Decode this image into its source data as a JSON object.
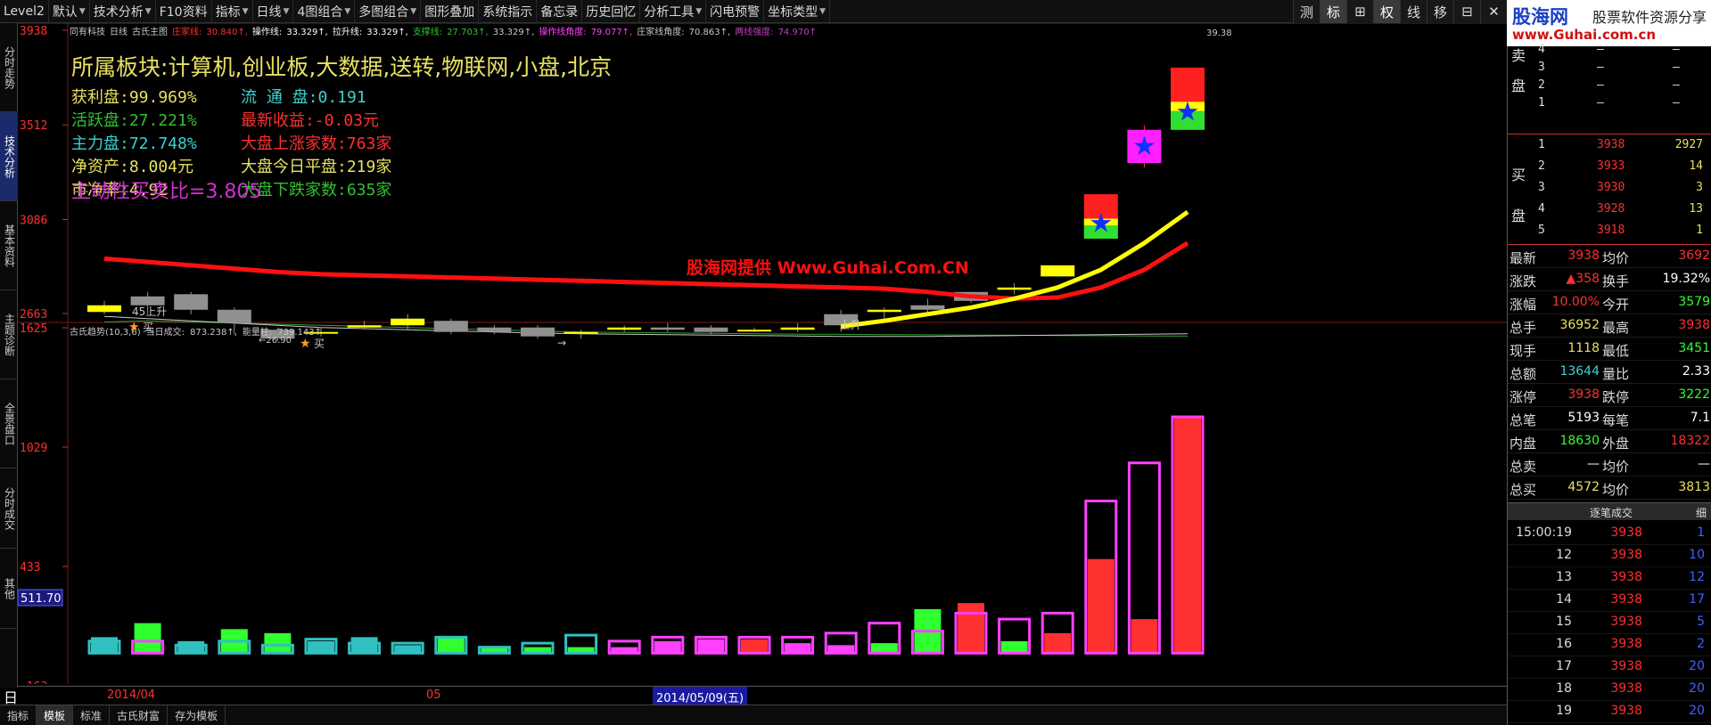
{
  "menu": [
    {
      "label": "Level2",
      "dd": false
    },
    {
      "label": "默认",
      "dd": true
    },
    {
      "label": "技术分析",
      "dd": true
    },
    {
      "label": "F10资料",
      "dd": false
    },
    {
      "label": "指标",
      "dd": true
    },
    {
      "label": "日线",
      "dd": true
    },
    {
      "label": "4图组合",
      "dd": true
    },
    {
      "label": "多图组合",
      "dd": true
    },
    {
      "label": "图形叠加",
      "dd": false
    },
    {
      "label": "系统指示",
      "dd": false
    },
    {
      "label": "备忘录",
      "dd": false
    },
    {
      "label": "历史回忆",
      "dd": false
    },
    {
      "label": "分析工具",
      "dd": true
    },
    {
      "label": "闪电预警",
      "dd": false
    },
    {
      "label": "坐标类型",
      "dd": true
    }
  ],
  "tool_buttons": [
    {
      "label": "测",
      "on": false
    },
    {
      "label": "标",
      "on": true
    },
    {
      "label": "⊞",
      "on": false
    },
    {
      "label": "权",
      "on": true
    },
    {
      "label": "线",
      "on": false
    },
    {
      "label": "移",
      "on": false
    },
    {
      "label": "⊟",
      "on": false
    },
    {
      "label": "✕",
      "on": false
    }
  ],
  "logo": {
    "l1": "股海网",
    "l2": "股票软件资源分享",
    "l3": "www.Guhai.com.cn"
  },
  "left_tabs": [
    {
      "label": "分时走势",
      "active": false
    },
    {
      "label": "技术分析",
      "active": true
    },
    {
      "label": "基本资料",
      "active": false
    },
    {
      "label": "主题诊断",
      "active": false
    },
    {
      "label": "全景盘口",
      "active": false
    },
    {
      "label": "分时成交",
      "active": false
    },
    {
      "label": "其他",
      "active": false
    }
  ],
  "header_line": [
    {
      "t": "同有科技",
      "c": "#c8c8c8"
    },
    {
      "t": "日线",
      "c": "#c8c8c8"
    },
    {
      "t": "古氏主图",
      "c": "#c8c8c8"
    },
    {
      "t": "庄家线:",
      "c": "#ff3030"
    },
    {
      "t": "30.840↑,",
      "c": "#ff3030"
    },
    {
      "t": "操作线:",
      "c": "#ffffff"
    },
    {
      "t": "33.329↑,",
      "c": "#ffffff"
    },
    {
      "t": "拉升线:",
      "c": "#ffffff"
    },
    {
      "t": "33.329↑,",
      "c": "#ffffff"
    },
    {
      "t": "支撑线:",
      "c": "#30c030"
    },
    {
      "t": "27.703↑,",
      "c": "#30c030"
    },
    {
      "t": "33.329↑,",
      "c": "#c8c8c8"
    },
    {
      "t": "操作线角度:",
      "c": "#ff40ff"
    },
    {
      "t": "79.077↑,",
      "c": "#ff40ff"
    },
    {
      "t": "庄家线角度:",
      "c": "#c8c8c8"
    },
    {
      "t": "70.863↑,",
      "c": "#c8c8c8"
    },
    {
      "t": "两线强度:",
      "c": "#c040c0"
    },
    {
      "t": "74.970↑",
      "c": "#c040c0"
    }
  ],
  "info": {
    "sector_prefix": "所属板块:",
    "sector": "计算机,创业板,大数据,送转,物联网,小盘,北京",
    "rows": [
      [
        {
          "t": "获利盘:99.969%",
          "c": "#e8e060"
        },
        {
          "t": "流 通 盘:0.191",
          "c": "#40d0d0"
        }
      ],
      [
        {
          "t": "活跃盘:27.221%",
          "c": "#30c030"
        },
        {
          "t": "最新收益:-0.03元",
          "c": "#ff3030"
        }
      ],
      [
        {
          "t": "主力盘:72.748%",
          "c": "#40d0d0"
        },
        {
          "t": "大盘上涨家数:763家",
          "c": "#ff3030"
        }
      ],
      [
        {
          "t": "净资产:8.004元",
          "c": "#e8e060"
        },
        {
          "t": "大盘今日平盘:219家",
          "c": "#e8e060"
        }
      ],
      [
        {
          "t": "市净率:4.92",
          "c": "#e8e060"
        },
        {
          "t": "大盘下跌家数:635家",
          "c": "#30c030"
        }
      ]
    ],
    "ratio": "主动性买卖比=3.805"
  },
  "chart_data": {
    "type": "candlestick",
    "price_ticks": [
      "3938",
      "3512",
      "3086",
      "2663"
    ],
    "vol_ticks": [
      "1625",
      "1029",
      "433",
      "-163"
    ],
    "left_readout": "511.70",
    "high_label": "39.38",
    "candles": [
      {
        "o": 26.7,
        "c": 27.0,
        "h": 27.2,
        "l": 26.6
      },
      {
        "o": 27.4,
        "c": 27.0,
        "h": 27.6,
        "l": 26.6
      },
      {
        "o": 27.5,
        "c": 26.8,
        "h": 27.6,
        "l": 26.6
      },
      {
        "o": 26.8,
        "c": 26.2,
        "h": 26.9,
        "l": 25.7
      },
      {
        "o": 25.9,
        "c": 25.5,
        "h": 26.0,
        "l": 25.4
      },
      {
        "o": 25.8,
        "c": 25.8,
        "h": 26.0,
        "l": 25.6
      },
      {
        "o": 26.0,
        "c": 26.1,
        "h": 26.3,
        "l": 25.9
      },
      {
        "o": 26.1,
        "c": 26.4,
        "h": 26.6,
        "l": 25.9
      },
      {
        "o": 26.3,
        "c": 25.8,
        "h": 26.4,
        "l": 25.7
      },
      {
        "o": 26.0,
        "c": 25.8,
        "h": 26.1,
        "l": 25.7
      },
      {
        "o": 26.0,
        "c": 25.6,
        "h": 26.1,
        "l": 25.5
      },
      {
        "o": 25.8,
        "c": 25.8,
        "h": 25.9,
        "l": 25.5
      },
      {
        "o": 25.9,
        "c": 26.0,
        "h": 26.1,
        "l": 25.8
      },
      {
        "o": 26.0,
        "c": 25.9,
        "h": 26.2,
        "l": 25.8
      },
      {
        "o": 26.0,
        "c": 25.8,
        "h": 26.1,
        "l": 25.7
      },
      {
        "o": 25.9,
        "c": 25.9,
        "h": 26.0,
        "l": 25.8
      },
      {
        "o": 25.9,
        "c": 26.0,
        "h": 26.2,
        "l": 25.8
      },
      {
        "o": 26.6,
        "c": 26.1,
        "h": 26.8,
        "l": 25.8
      },
      {
        "o": 26.7,
        "c": 26.8,
        "h": 26.9,
        "l": 26.4
      },
      {
        "o": 27.0,
        "c": 26.8,
        "h": 27.3,
        "l": 26.7
      },
      {
        "o": 27.6,
        "c": 27.2,
        "h": 27.6,
        "l": 27.1
      },
      {
        "o": 27.7,
        "c": 27.8,
        "h": 28.0,
        "l": 27.5
      },
      {
        "o": 28.3,
        "c": 28.8,
        "h": 28.8,
        "l": 28.3
      },
      {
        "o": 30.0,
        "c": 32.0,
        "h": 32.0,
        "l": 30.0
      },
      {
        "o": 33.4,
        "c": 34.9,
        "h": 35.1,
        "l": 33.2
      },
      {
        "o": 34.9,
        "c": 37.7,
        "h": 37.7,
        "l": 34.9
      }
    ],
    "star_candles": [
      23,
      24,
      25
    ],
    "red_line": [
      29.1,
      28.95,
      28.8,
      28.65,
      28.5,
      28.4,
      28.35,
      28.3,
      28.25,
      28.2,
      28.15,
      28.1,
      28.05,
      28.0,
      27.95,
      27.9,
      27.85,
      27.8,
      27.75,
      27.6,
      27.4,
      27.3,
      27.35,
      27.8,
      28.6,
      29.8
    ],
    "yellow_line": [
      null,
      null,
      null,
      null,
      null,
      null,
      null,
      null,
      null,
      null,
      null,
      null,
      null,
      null,
      null,
      null,
      null,
      26.05,
      26.3,
      26.6,
      26.9,
      27.3,
      27.8,
      28.6,
      29.8,
      31.2
    ],
    "white_line": [
      26.5,
      26.4,
      26.3,
      26.2,
      26.1,
      26.0,
      25.95,
      25.9,
      25.85,
      25.8,
      25.75,
      25.72,
      25.7,
      25.68,
      25.66,
      25.64,
      25.62,
      25.6,
      25.6,
      25.6,
      25.62,
      25.64,
      25.66,
      25.68,
      25.7,
      25.72
    ],
    "green_line": [
      26.25,
      26.3,
      26.25,
      26.2,
      26.15,
      26.1,
      26.05,
      26.0,
      25.95,
      25.9,
      25.85,
      25.8,
      25.78,
      25.76,
      25.74,
      25.72,
      25.7,
      25.69,
      25.68,
      25.67,
      25.66,
      25.65,
      25.64,
      25.63,
      25.62,
      25.61
    ],
    "volume": [
      {
        "v": 80,
        "box": 60,
        "bc": "#30c0c0"
      },
      {
        "v": 150,
        "box": 60,
        "bc": "#ff40ff"
      },
      {
        "v": 60,
        "box": 40,
        "bc": "#30c0c0"
      },
      {
        "v": 120,
        "box": 60,
        "bc": "#30c0c0"
      },
      {
        "v": 100,
        "box": 40,
        "bc": "#30c0c0"
      },
      {
        "v": 60,
        "box": 70,
        "bc": "#30c0c0"
      },
      {
        "v": 80,
        "box": 50,
        "bc": "#30c0c0"
      },
      {
        "v": 40,
        "box": 50,
        "bc": "#30c0c0"
      },
      {
        "v": 80,
        "box": 80,
        "bc": "#30c0c0"
      },
      {
        "v": 30,
        "box": 30,
        "bc": "#30c0c0"
      },
      {
        "v": 30,
        "box": 50,
        "bc": "#30c0c0"
      },
      {
        "v": 30,
        "box": 90,
        "bc": "#30c0c0"
      },
      {
        "v": 30,
        "box": 60,
        "bc": "#ff40ff"
      },
      {
        "v": 60,
        "box": 80,
        "bc": "#ff40ff"
      },
      {
        "v": 70,
        "box": 80,
        "bc": "#ff40ff"
      },
      {
        "v": 70,
        "box": 80,
        "bc": "#ff40ff"
      },
      {
        "v": 50,
        "box": 80,
        "bc": "#ff40ff"
      },
      {
        "v": 40,
        "box": 100,
        "bc": "#ff40ff"
      },
      {
        "v": 50,
        "box": 150,
        "bc": "#ff40ff"
      },
      {
        "v": 220,
        "box": 110,
        "bc": "#ff40ff"
      },
      {
        "v": 250,
        "box": 200,
        "bc": "#ff40ff"
      },
      {
        "v": 60,
        "box": 170,
        "bc": "#ff40ff"
      },
      {
        "v": 100,
        "box": 200,
        "bc": "#ff40ff"
      },
      {
        "v": 470,
        "box": 760,
        "bc": "#ff40ff"
      },
      {
        "v": 170,
        "box": 950,
        "bc": "#ff40ff"
      },
      {
        "v": 1180,
        "box": 1180,
        "bc": "#ff40ff"
      }
    ],
    "vol_colors": [
      "#30c0c0",
      "#30ff30",
      "#30c0c0",
      "#30ff30",
      "#30ff30",
      "#30c0c0",
      "#30c0c0",
      "#30c0c0",
      "#30ff30",
      "#30ff30",
      "#30ff30",
      "#30ff30",
      "#ff40ff",
      "#ff40ff",
      "#ff40ff",
      "#ff3030",
      "#ff40ff",
      "#ff40ff",
      "#30ff30",
      "#30ff30",
      "#ff3030",
      "#30ff30",
      "#ff3030",
      "#ff3030",
      "#ff3030",
      "#ff3030"
    ]
  },
  "annotations": {
    "a1": "45上升",
    "a2": "买",
    "a3": "←26.90",
    "a4": "买",
    "a5": "上升",
    "a6": "→"
  },
  "watermark": "股海网提供 Www.Guhai.Com.CN",
  "vol_header": [
    {
      "t": "古氏趋势(10,3,6)",
      "c": "#c8c8c8"
    },
    {
      "t": "当日成交:",
      "c": "#c8c8c8"
    },
    {
      "t": "873.238↑,",
      "c": "#c8c8c8"
    },
    {
      "t": "能量柱:",
      "c": "#c8c8c8"
    },
    {
      "t": "739.143↑",
      "c": "#c8c8c8"
    }
  ],
  "dates": {
    "d1": "2014/04",
    "d2": "05",
    "d3": "2014/05/09(五)"
  },
  "period": "日线",
  "bottom_tabs": [
    {
      "label": "指标",
      "active": false
    },
    {
      "label": "模板",
      "active": true
    },
    {
      "label": "标准",
      "active": false
    },
    {
      "label": "古氏财富",
      "active": false
    },
    {
      "label": "存为模板",
      "active": false
    }
  ],
  "orderbook": {
    "sell_label": "卖盘",
    "buy_label": "买盘",
    "sell": [
      {
        "lvl": "4",
        "p": "—",
        "v": "—"
      },
      {
        "lvl": "3",
        "p": "—",
        "v": "—"
      },
      {
        "lvl": "2",
        "p": "—",
        "v": "—"
      },
      {
        "lvl": "1",
        "p": "—",
        "v": "—"
      }
    ],
    "buy": [
      {
        "lvl": "1",
        "p": "3938",
        "v": "2927"
      },
      {
        "lvl": "2",
        "p": "3933",
        "v": "14"
      },
      {
        "lvl": "3",
        "p": "3930",
        "v": "3"
      },
      {
        "lvl": "4",
        "p": "3928",
        "v": "13"
      },
      {
        "lvl": "5",
        "p": "3918",
        "v": "1"
      }
    ]
  },
  "quotes": [
    {
      "k1": "最新",
      "v1": "3938",
      "c1": "#ff3030",
      "k2": "均价",
      "v2": "3692",
      "c2": "#ff3030"
    },
    {
      "k1": "涨跌",
      "v1": "▲358",
      "c1": "#ff3030",
      "k2": "换手",
      "v2": "19.32%",
      "c2": "#ffffff"
    },
    {
      "k1": "涨幅",
      "v1": "10.00%",
      "c1": "#ff3030",
      "k2": "今开",
      "v2": "3579",
      "c2": "#30ff30"
    },
    {
      "k1": "总手",
      "v1": "36952",
      "c1": "#e8e060",
      "k2": "最高",
      "v2": "3938",
      "c2": "#ff3030"
    },
    {
      "k1": "现手",
      "v1": "1118",
      "c1": "#e8e060",
      "k2": "最低",
      "v2": "3451",
      "c2": "#30ff30"
    },
    {
      "k1": "总额",
      "v1": "13644",
      "c1": "#40d0d0",
      "k2": "量比",
      "v2": "2.33",
      "c2": "#ffffff"
    },
    {
      "k1": "涨停",
      "v1": "3938",
      "c1": "#ff3030",
      "k2": "跌停",
      "v2": "3222",
      "c2": "#30ff30"
    },
    {
      "k1": "总笔",
      "v1": "5193",
      "c1": "#ffffff",
      "k2": "每笔",
      "v2": "7.1",
      "c2": "#ffffff"
    },
    {
      "k1": "内盘",
      "v1": "18630",
      "c1": "#30ff30",
      "k2": "外盘",
      "v2": "18322",
      "c2": "#ff3030"
    },
    {
      "k1": "总卖",
      "v1": "—",
      "c1": "#ffffff",
      "k2": "均价",
      "v2": "—",
      "c2": "#ffffff"
    },
    {
      "k1": "总买",
      "v1": "4572",
      "c1": "#e8e060",
      "k2": "均价",
      "v2": "3813",
      "c2": "#e8e060"
    }
  ],
  "trades_header": "逐笔成交",
  "trades_header_right": "细",
  "trades": [
    {
      "t": "15:00:19",
      "p": "3938",
      "v": "1"
    },
    {
      "t": "12",
      "p": "3938",
      "v": "10"
    },
    {
      "t": "13",
      "p": "3938",
      "v": "12"
    },
    {
      "t": "14",
      "p": "3938",
      "v": "17"
    },
    {
      "t": "15",
      "p": "3938",
      "v": "5"
    },
    {
      "t": "16",
      "p": "3938",
      "v": "2"
    },
    {
      "t": "17",
      "p": "3938",
      "v": "20"
    },
    {
      "t": "18",
      "p": "3938",
      "v": "20"
    },
    {
      "t": "19",
      "p": "3938",
      "v": "20"
    },
    {
      "t": "20",
      "p": "3938",
      "v": "1"
    }
  ]
}
